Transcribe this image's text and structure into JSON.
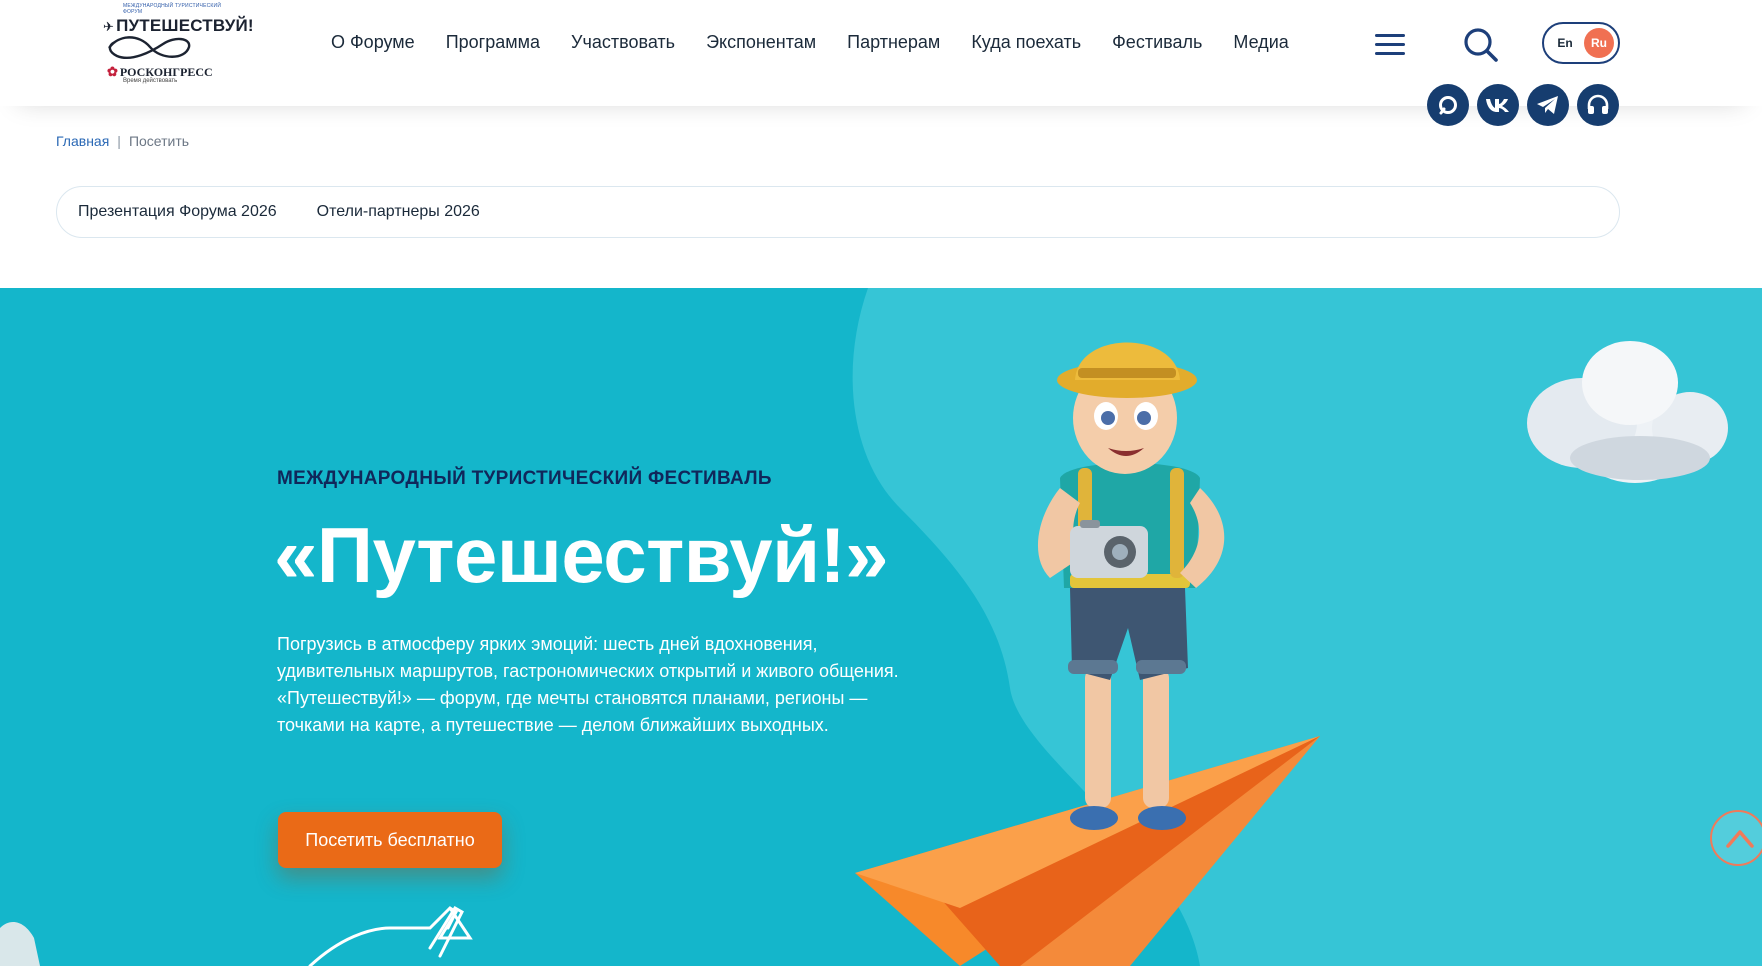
{
  "logo": {
    "small_text": "МЕЖДУНАРОДНЫЙ ТУРИСТИЧЕСКИЙ ФОРУМ",
    "name": "ПУТЕШЕСТВУЙ!",
    "partner": "РОСКОНГРЕСС",
    "partner_tagline": "Время действовать"
  },
  "nav": {
    "items": [
      "О Форуме",
      "Программа",
      "Участвовать",
      "Экспонентам",
      "Партнерам",
      "Куда поехать",
      "Фестиваль",
      "Медиа"
    ],
    "menu_icon": "hamburger-menu-icon",
    "search_icon": "search-icon"
  },
  "lang": {
    "en": "En",
    "ru": "Ru",
    "active": "Ru"
  },
  "socials": [
    {
      "icon": "max-messenger-icon",
      "glyph": "◯"
    },
    {
      "icon": "vk-icon",
      "glyph": "vk"
    },
    {
      "icon": "telegram-icon",
      "glyph": "➤"
    },
    {
      "icon": "headphones-icon",
      "glyph": "🎧"
    }
  ],
  "breadcrumb": {
    "home": "Главная",
    "separator": "|",
    "current": "Посетить"
  },
  "subtabs": [
    "Презентация Форума 2026",
    "Отели-партнеры 2026"
  ],
  "hero": {
    "kicker": "МЕЖДУНАРОДНЫЙ ТУРИСТИЧЕСКИЙ ФЕСТИВАЛЬ",
    "title": "«Путешествуй!»",
    "text": "Погрузись в атмосферу ярких эмоций: шесть дней вдохновения, удивительных маршрутов, гастрономических открытий и живого общения. «Путешествуй!» — форум, где мечты становятся планами, регионы — точками на карте, а путешествие — делом ближайших выходных.",
    "button": "Посетить бесплатно"
  },
  "colors": {
    "hero_bg": "#14b6cb",
    "hero_bg_light": "#36c5d6",
    "accent_orange": "#ea6a17",
    "navy": "#163d6f",
    "lang_active": "#f07052"
  },
  "icons": {
    "scroll_top": "chevron-up-icon",
    "cloud": "cloud-illustration",
    "traveler": "traveler-boy-illustration",
    "paper_plane": "paper-plane-illustration"
  }
}
